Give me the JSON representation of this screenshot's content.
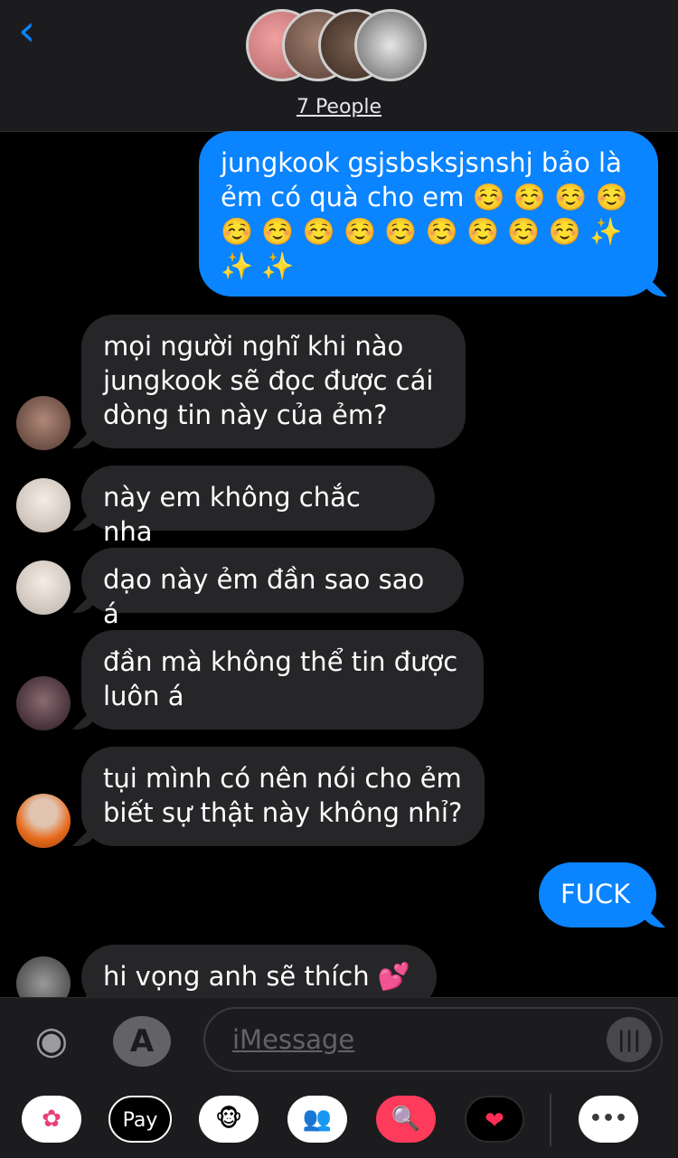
{
  "header": {
    "back": "‹",
    "people_label": "7 People"
  },
  "messages": {
    "m1": "jungkook gsjsbsksjsnshj bảo là ẻm có quà cho em ☺️ ☺️ ☺️ ☺️ ☺️ ☺️ ☺️ ☺️ ☺️ ☺️ ☺️ ☺️ ☺️ ✨ ✨ ✨",
    "m2": "mọi người nghĩ khi nào jungkook sẽ đọc được cái dòng tin này của ẻm?",
    "m3": "này em không chắc nha",
    "m4": "dạo này ẻm đần sao sao á",
    "m5": "đần mà không thể tin được luôn á",
    "m6": "tụi mình có nên nói cho ẻm biết sự thật này không nhỉ?",
    "m7": "FUCK",
    "m8": "hi vọng anh sẽ thích 💕"
  },
  "compose": {
    "placeholder": "iMessage",
    "camera_icon": "◉",
    "appstore_icon": "A",
    "audio_icon": "|||",
    "apps": {
      "photos": "✿",
      "applepay": " Pay",
      "animoji": "🐵",
      "memoji": "👥",
      "search": "🔍",
      "digitaltouch": "❤",
      "more": "•••"
    }
  },
  "colors": {
    "sent": "#0a84ff",
    "received": "#262629",
    "accent": "#0a84ff"
  }
}
